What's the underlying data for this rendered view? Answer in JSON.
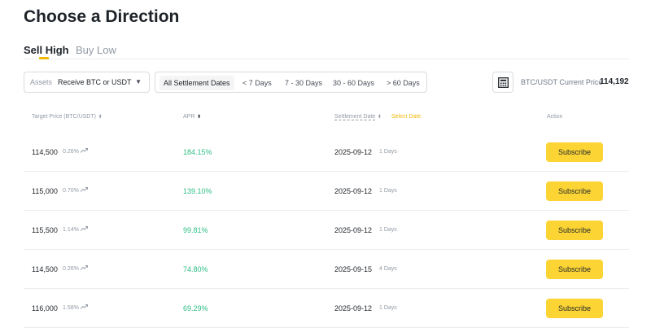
{
  "page": {
    "title": "Choose a Direction"
  },
  "tabs": [
    {
      "label": "Sell High",
      "active": true
    },
    {
      "label": "Buy Low",
      "active": false
    }
  ],
  "assets": {
    "label": "Assets",
    "value": "Receive BTC or USDT"
  },
  "date_filters": [
    {
      "label": "All Settlement Dates",
      "active": true
    },
    {
      "label": "< 7 Days",
      "active": false
    },
    {
      "label": "7 - 30 Days",
      "active": false
    },
    {
      "label": "30 - 60 Days",
      "active": false
    },
    {
      "label": "> 60 Days",
      "active": false
    }
  ],
  "current_price": {
    "label": "BTC/USDT Current Price",
    "value": "114,192"
  },
  "table": {
    "headers": {
      "target_price": "Target Price (BTC/USDT)",
      "apr": "APR",
      "settlement_date": "Settlement Date",
      "select_date": "Select Date",
      "action": "Action"
    },
    "rows": [
      {
        "price": "114,500",
        "pct": "0.26%",
        "apr": "184.15%",
        "date": "2025-09-12",
        "days": "1 Days",
        "action": "Subscribe"
      },
      {
        "price": "115,000",
        "pct": "0.70%",
        "apr": "139.10%",
        "date": "2025-09-12",
        "days": "1 Days",
        "action": "Subscribe"
      },
      {
        "price": "115,500",
        "pct": "1.14%",
        "apr": "99.81%",
        "date": "2025-09-12",
        "days": "1 Days",
        "action": "Subscribe"
      },
      {
        "price": "114,500",
        "pct": "0.26%",
        "apr": "74.80%",
        "date": "2025-09-15",
        "days": "4 Days",
        "action": "Subscribe"
      },
      {
        "price": "116,000",
        "pct": "1.58%",
        "apr": "69.29%",
        "date": "2025-09-12",
        "days": "1 Days",
        "action": "Subscribe"
      }
    ]
  },
  "colors": {
    "accent": "#f0b90b",
    "button": "#fcd535",
    "positive": "#2ebd85"
  },
  "icons": {
    "calculator": "calculator-icon",
    "trend": "trend-up-icon",
    "caret": "caret-down-icon",
    "sort": "sort-icon"
  }
}
